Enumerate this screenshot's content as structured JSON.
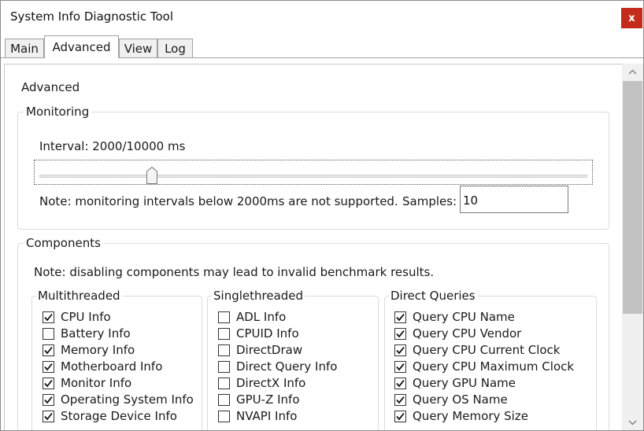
{
  "window": {
    "title": "System Info Diagnostic Tool",
    "close_glyph": "x"
  },
  "tabs": [
    {
      "label": "Main",
      "active": false
    },
    {
      "label": "Advanced",
      "active": true
    },
    {
      "label": "View",
      "active": false
    },
    {
      "label": "Log",
      "active": false
    }
  ],
  "advanced": {
    "heading": "Advanced",
    "monitoring": {
      "legend": "Monitoring",
      "interval_label": "Interval: 2000/10000 ms",
      "slider": {
        "value": 2000,
        "max": 10000
      },
      "note": "Note: monitoring intervals below 2000ms are not supported.",
      "samples_label": "Samples:",
      "samples_value": "10"
    },
    "components": {
      "legend": "Components",
      "note": "Note: disabling components may lead to invalid benchmark results.",
      "multithreaded": {
        "legend": "Multithreaded",
        "items": [
          {
            "label": "CPU Info",
            "checked": true
          },
          {
            "label": "Battery Info",
            "checked": false
          },
          {
            "label": "Memory Info",
            "checked": true
          },
          {
            "label": "Motherboard Info",
            "checked": true
          },
          {
            "label": "Monitor Info",
            "checked": true
          },
          {
            "label": "Operating System Info",
            "checked": true
          },
          {
            "label": "Storage Device Info",
            "checked": true
          }
        ]
      },
      "singlethreaded": {
        "legend": "Singlethreaded",
        "items": [
          {
            "label": "ADL Info",
            "checked": false
          },
          {
            "label": "CPUID Info",
            "checked": false
          },
          {
            "label": "DirectDraw",
            "checked": false
          },
          {
            "label": "Direct Query Info",
            "checked": false
          },
          {
            "label": "DirectX Info",
            "checked": false
          },
          {
            "label": "GPU-Z Info",
            "checked": false
          },
          {
            "label": "NVAPI Info",
            "checked": false
          }
        ]
      },
      "direct_queries": {
        "legend": "Direct Queries",
        "items": [
          {
            "label": "Query CPU Name",
            "checked": true
          },
          {
            "label": "Query CPU Vendor",
            "checked": true
          },
          {
            "label": "Query CPU Current Clock",
            "checked": true
          },
          {
            "label": "Query CPU Maximum Clock",
            "checked": true
          },
          {
            "label": "Query GPU Name",
            "checked": true
          },
          {
            "label": "Query OS Name",
            "checked": true
          },
          {
            "label": "Query Memory Size",
            "checked": true
          }
        ]
      }
    }
  },
  "icons": {
    "close": "close-icon",
    "scroll_up": "chevron-up-icon",
    "scroll_down": "chevron-down-icon",
    "check": "checkmark-icon"
  }
}
